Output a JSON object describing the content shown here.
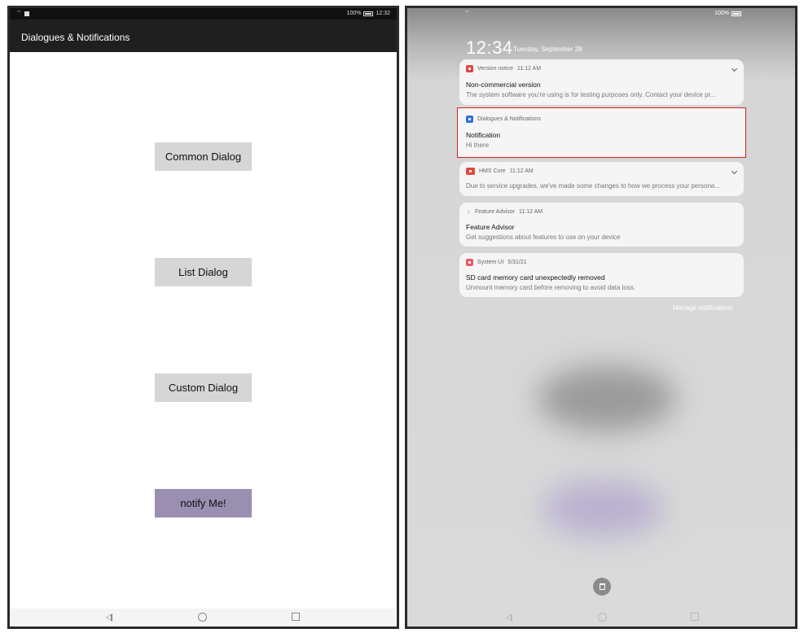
{
  "left": {
    "status": {
      "battery": "100%",
      "time": "12:32"
    },
    "appbar": {
      "title": "Dialogues & Notifications"
    },
    "buttons": {
      "common": "Common Dialog",
      "list": "List Dialog",
      "custom": "Custom Dialog",
      "notify": "notify Me!"
    }
  },
  "right": {
    "status": {
      "battery": "100%"
    },
    "clock": {
      "time": "12:34",
      "date": "Tuesday, September 28"
    },
    "notifications": [
      {
        "app": "Version notice",
        "time": "11:12 AM",
        "title": "Non-commercial version",
        "body": "The system software you're using is for testing purposes only. Contact your device pr..."
      },
      {
        "app": "Dialogues & Notifications",
        "time": "",
        "title": "Notification",
        "body": "Hi there"
      },
      {
        "app": "HMS Core",
        "time": "11:12 AM",
        "title": "",
        "body": "Due to service upgrades, we've made some changes to how we process your persona..."
      },
      {
        "app": "Feature Advisor",
        "time": "11:12 AM",
        "title": "Feature Advisor",
        "body": "Get suggestions about features to use on your device"
      },
      {
        "app": "System UI",
        "time": "5/31/21",
        "title": "SD card memory card unexpectedly removed",
        "body": "Unmount memory card before removing to avoid data loss."
      }
    ],
    "manage_label": "Manage notifications"
  },
  "colors": {
    "highlight": "#d61f1f",
    "notify_button": "#9a8fb0",
    "appbar": "#1f1f1f"
  }
}
